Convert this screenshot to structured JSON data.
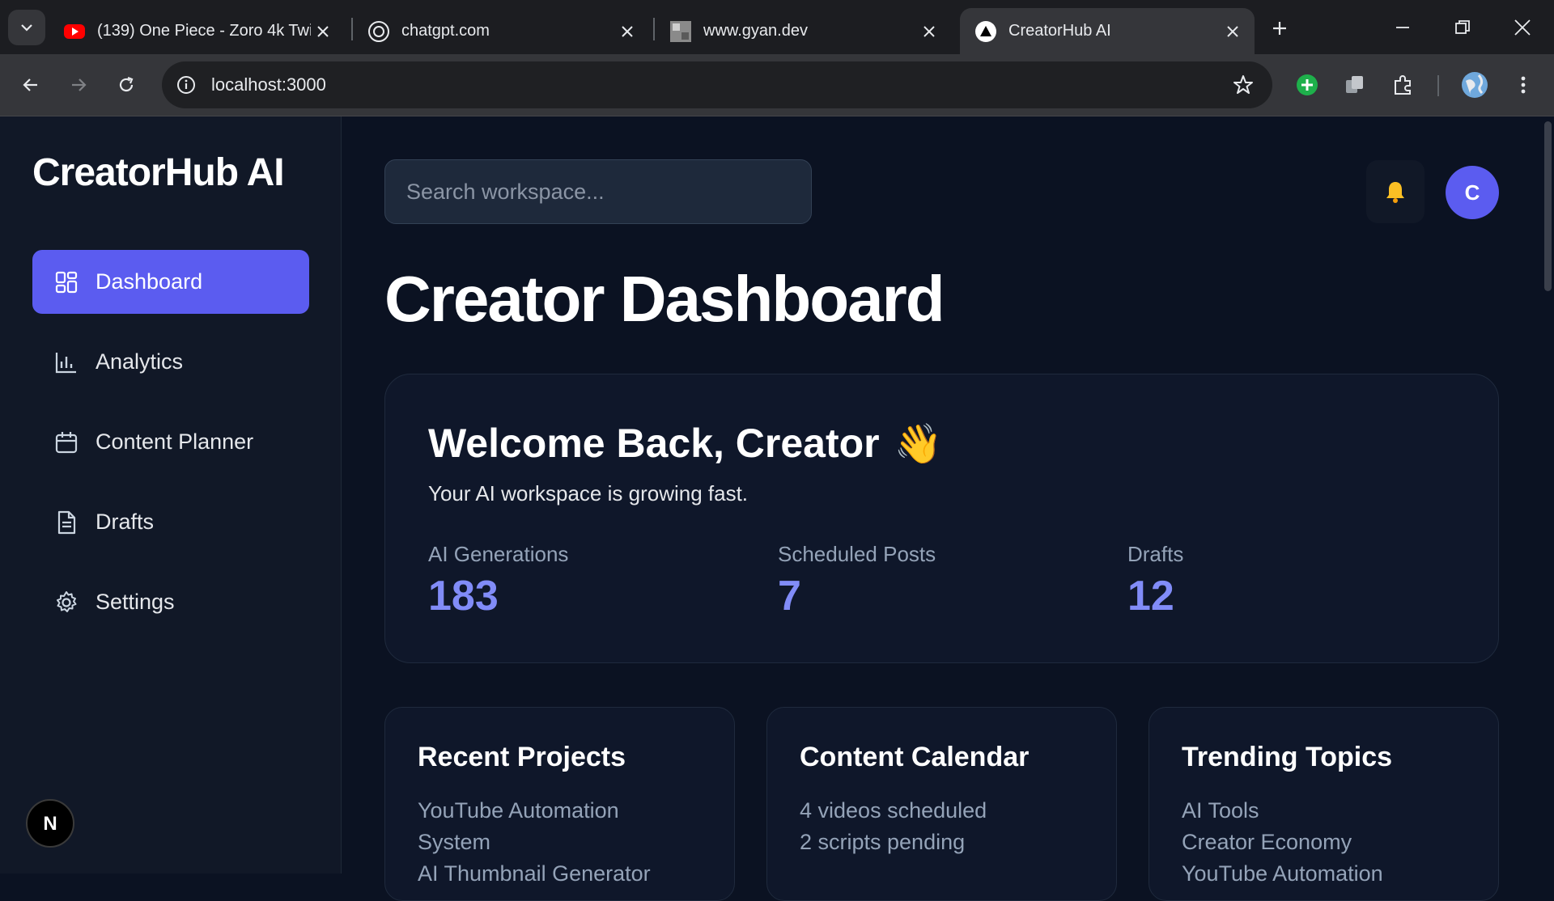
{
  "browser": {
    "tabs": [
      {
        "title": "(139) One Piece - Zoro 4k Twi",
        "favicon": "youtube-icon"
      },
      {
        "title": "chatgpt.com",
        "favicon": "chatgpt-icon"
      },
      {
        "title": "www.gyan.dev",
        "favicon": "page-thumbnail-icon"
      },
      {
        "title": "CreatorHub AI",
        "favicon": "nextjs-triangle-icon",
        "active": true
      }
    ],
    "url": "localhost:3000"
  },
  "sidebar": {
    "logo": "CreatorHub AI",
    "items": [
      {
        "label": "Dashboard",
        "icon": "grid-icon",
        "active": true
      },
      {
        "label": "Analytics",
        "icon": "bar-chart-icon"
      },
      {
        "label": "Content Planner",
        "icon": "calendar-icon"
      },
      {
        "label": "Drafts",
        "icon": "document-icon"
      },
      {
        "label": "Settings",
        "icon": "gear-icon"
      }
    ],
    "dev_badge": "N"
  },
  "header": {
    "search_placeholder": "Search workspace...",
    "avatar_initial": "C"
  },
  "main": {
    "title": "Creator Dashboard",
    "welcome": {
      "title": "Welcome Back, Creator",
      "emoji": "👋",
      "subtitle": "Your AI workspace is growing fast.",
      "stats": [
        {
          "label": "AI Generations",
          "value": "183"
        },
        {
          "label": "Scheduled Posts",
          "value": "7"
        },
        {
          "label": "Drafts",
          "value": "12"
        }
      ]
    },
    "cards": [
      {
        "title": "Recent Projects",
        "lines": [
          "YouTube Automation",
          "System",
          "AI Thumbnail Generator"
        ]
      },
      {
        "title": "Content Calendar",
        "lines": [
          "4 videos scheduled",
          "2 scripts pending"
        ]
      },
      {
        "title": "Trending Topics",
        "lines": [
          "AI Tools",
          "Creator Economy",
          "YouTube Automation"
        ]
      }
    ]
  },
  "colors": {
    "accent": "#5b5cf0",
    "stat_value": "#818cf8",
    "background": "#0b1222",
    "sidebar": "#111827"
  }
}
